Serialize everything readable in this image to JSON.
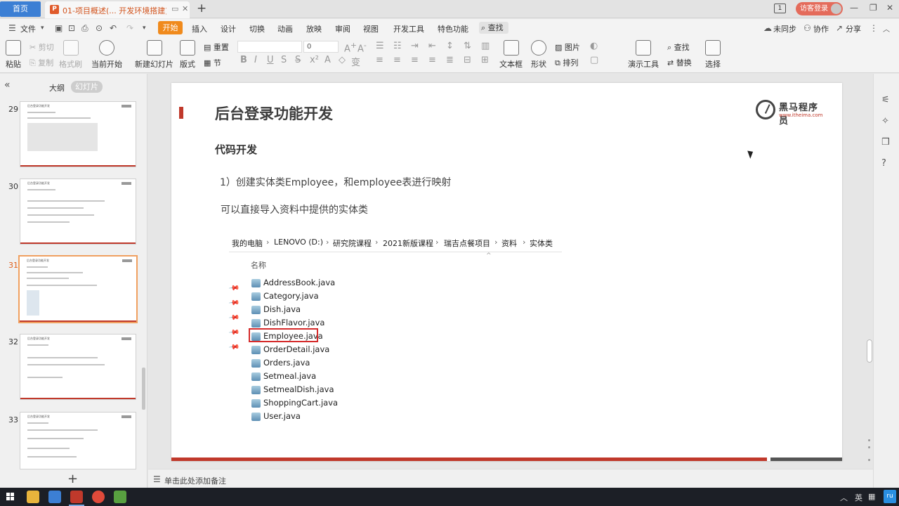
{
  "titlebar": {
    "home_tab": "首页",
    "doc_tab": "01-项目概述(... 开发环境搭建)",
    "visitor_button": "访客登录",
    "window_count": "1"
  },
  "menu": {
    "file": "文件",
    "items": [
      "开始",
      "插入",
      "设计",
      "切换",
      "动画",
      "放映",
      "审阅",
      "视图",
      "开发工具",
      "特色功能"
    ],
    "search": "查找",
    "sync": "未同步",
    "collab": "协作",
    "share": "分享"
  },
  "ribbon": {
    "paste": "粘贴",
    "cut": "剪切",
    "copy": "复制",
    "format_painter": "格式刷",
    "from_current": "当前开始",
    "new_slide": "新建幻灯片",
    "layout": "版式",
    "section": "节",
    "reset": "重置",
    "font_size": "0",
    "text_box": "文本框",
    "shape": "形状",
    "picture": "图片",
    "arrange": "排列",
    "presentation_tools": "演示工具",
    "find": "查找",
    "replace": "替换",
    "select": "选择"
  },
  "leftpanel": {
    "view_outline": "大纲",
    "view_slides": "幻灯片",
    "slides": [
      {
        "num": "29",
        "title": "后台登录功能开发"
      },
      {
        "num": "30",
        "title": "后台登录功能开发"
      },
      {
        "num": "31",
        "title": "后台登录功能开发"
      },
      {
        "num": "32",
        "title": "后台登录功能开发"
      },
      {
        "num": "33",
        "title": "后台登录功能开发"
      }
    ]
  },
  "slide": {
    "title": "后台登录功能开发",
    "logo_brand": "黑马程序员",
    "logo_url": "www.itheima.com",
    "subtitle": "代码开发",
    "line1": "1）创建实体类Employee，和employee表进行映射",
    "line2": "可以直接导入资料中提供的实体类",
    "breadcrumb": [
      "我的电脑",
      "LENOVO (D:)",
      "研究院课程",
      "2021新版课程",
      "瑞吉点餐项目",
      "资料",
      "实体类"
    ],
    "column_header": "名称",
    "files": [
      "AddressBook.java",
      "Category.java",
      "Dish.java",
      "DishFlavor.java",
      "Employee.java",
      "OrderDetail.java",
      "Orders.java",
      "Setmeal.java",
      "SetmealDish.java",
      "ShoppingCart.java",
      "User.java"
    ],
    "highlighted_file": "Employee.java"
  },
  "notes": {
    "placeholder": "单击此处添加备注"
  },
  "taskbar": {
    "ime": "英",
    "accent_color": "#2a8ee0"
  }
}
